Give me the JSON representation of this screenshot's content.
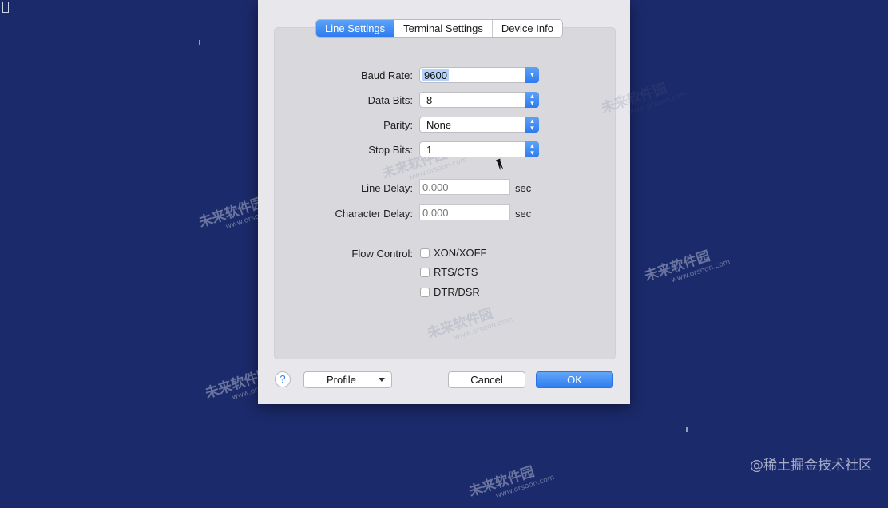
{
  "tabs": [
    {
      "label": "Line Settings",
      "active": true
    },
    {
      "label": "Terminal Settings",
      "active": false
    },
    {
      "label": "Device Info",
      "active": false
    }
  ],
  "fields": {
    "baud_rate": {
      "label": "Baud Rate:",
      "value": "9600"
    },
    "data_bits": {
      "label": "Data Bits:",
      "value": "8"
    },
    "parity": {
      "label": "Parity:",
      "value": "None"
    },
    "stop_bits": {
      "label": "Stop Bits:",
      "value": "1"
    },
    "line_delay": {
      "label": "Line Delay:",
      "placeholder": "0.000",
      "unit": "sec"
    },
    "character_delay": {
      "label": "Character Delay:",
      "placeholder": "0.000",
      "unit": "sec"
    }
  },
  "flow_control": {
    "label": "Flow Control:",
    "options": [
      {
        "label": "XON/XOFF",
        "checked": false
      },
      {
        "label": "RTS/CTS",
        "checked": false
      },
      {
        "label": "DTR/DSR",
        "checked": false
      }
    ]
  },
  "buttons": {
    "help": "?",
    "profile": "Profile",
    "cancel": "Cancel",
    "ok": "OK"
  },
  "watermark": {
    "corner": "@稀土掘金技术社区",
    "site_name": "未来软件园",
    "site_url": "www.orsoon.com"
  },
  "colors": {
    "desktop": "#1b2a6b",
    "accent": "#2d7bf0"
  }
}
